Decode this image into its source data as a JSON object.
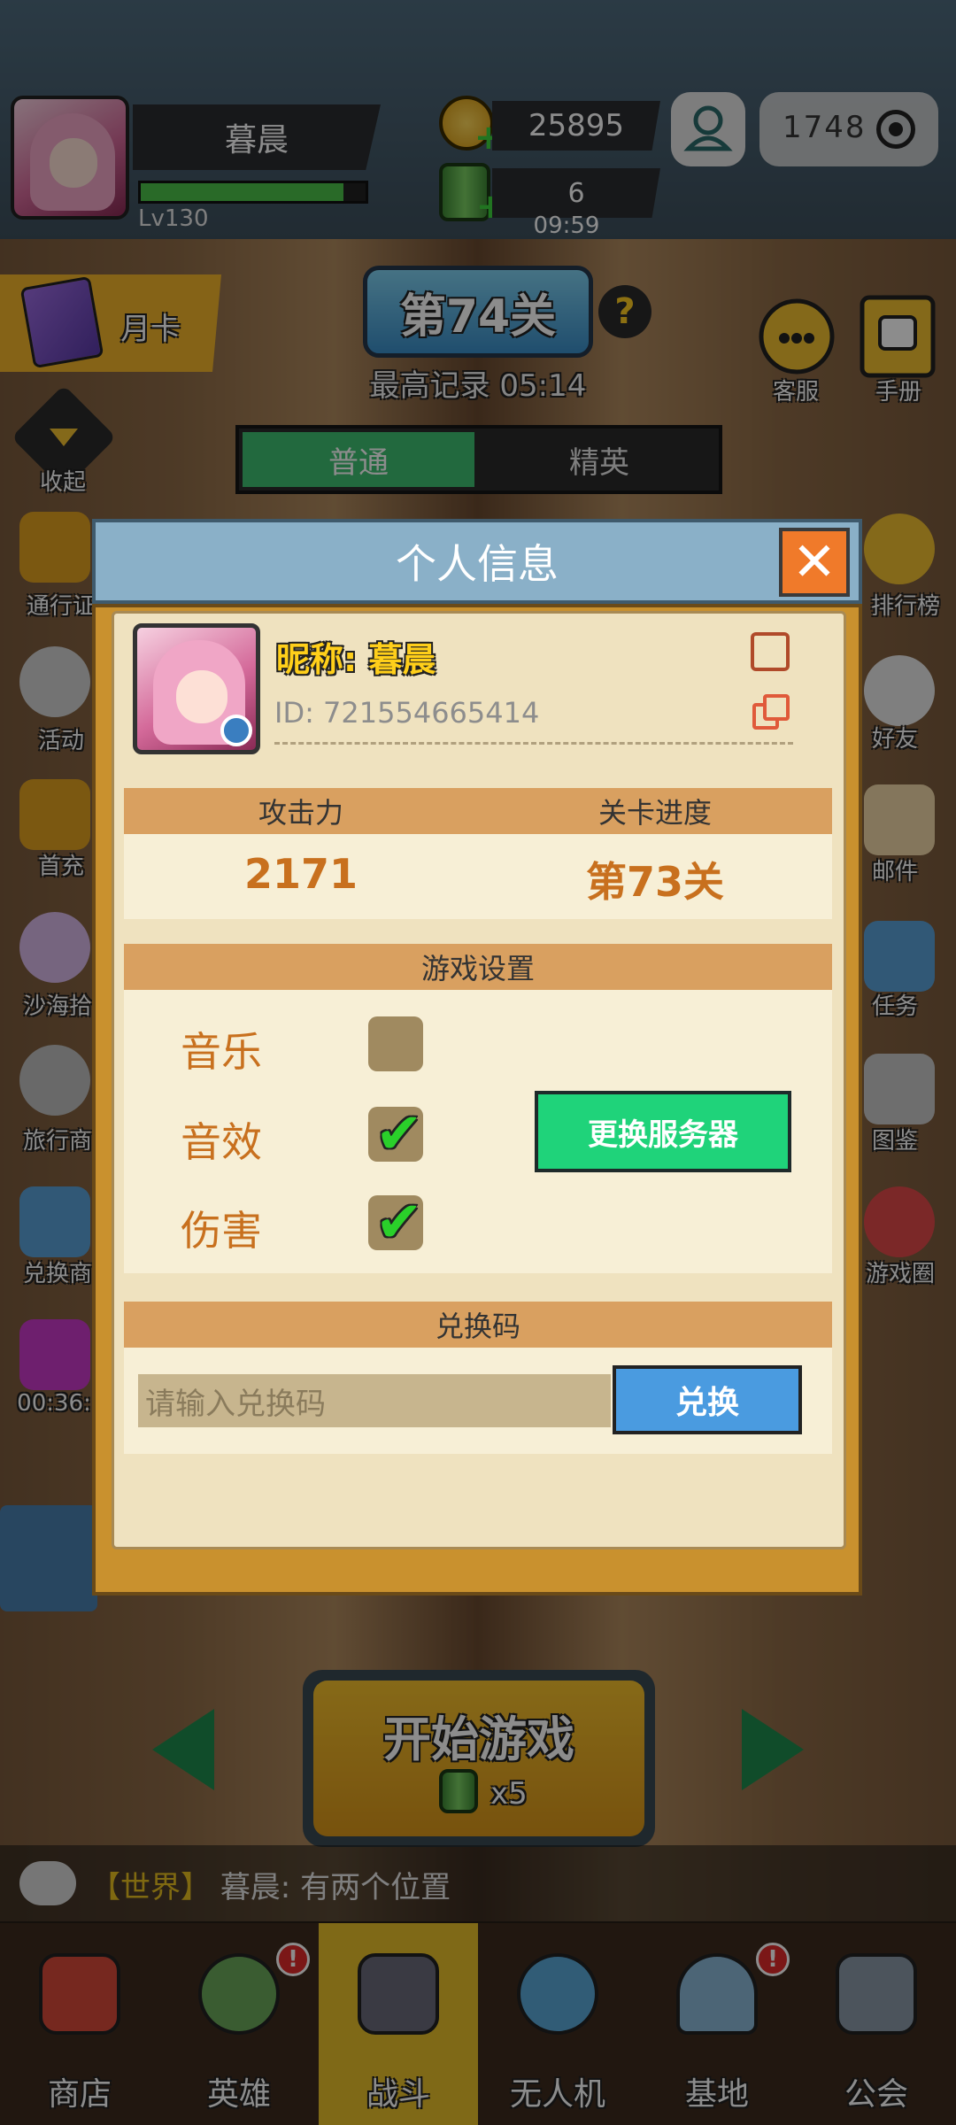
{
  "header": {
    "player_name": "暮晨",
    "level": "Lv130",
    "xp_fraction": 0.9,
    "coins": "25895",
    "energy": "6",
    "energy_timer": "09:59",
    "capsule_value": "1748"
  },
  "stage": {
    "title": "第74关",
    "best_record": "最高记录 05:14",
    "tabs": [
      "普通",
      "精英"
    ]
  },
  "left_menu": [
    {
      "label": "月卡"
    },
    {
      "label": "收起"
    },
    {
      "label": "通行证"
    },
    {
      "label": "活动"
    },
    {
      "label": "首充"
    },
    {
      "label": "沙海拾"
    },
    {
      "label": "旅行商"
    },
    {
      "label": "兑换商"
    },
    {
      "label": "00:36:"
    }
  ],
  "right_menu": [
    {
      "label": "客服"
    },
    {
      "label": "手册"
    },
    {
      "label": "排行榜"
    },
    {
      "label": "好友"
    },
    {
      "label": "邮件"
    },
    {
      "label": "任务"
    },
    {
      "label": "图鉴"
    },
    {
      "label": "游戏圈"
    }
  ],
  "modal": {
    "title": "个人信息",
    "nickname": "昵称: 暮晨",
    "id": "ID: 721554665414",
    "stats_headers": [
      "攻击力",
      "关卡进度"
    ],
    "stats_values": [
      "2171",
      "第73关"
    ],
    "settings_header": "游戏设置",
    "settings": [
      {
        "label": "音乐",
        "checked": false
      },
      {
        "label": "音效",
        "checked": true
      },
      {
        "label": "伤害",
        "checked": true
      }
    ],
    "switch_server": "更换服务器",
    "redeem_header": "兑换码",
    "redeem_placeholder": "请输入兑换码",
    "redeem_button": "兑换"
  },
  "start": {
    "label": "开始游戏",
    "cost": "x5"
  },
  "chat": {
    "channel": "【世界】",
    "message": "暮晨: 有两个位置"
  },
  "nav": [
    {
      "label": "商店"
    },
    {
      "label": "英雄"
    },
    {
      "label": "战斗"
    },
    {
      "label": "无人机"
    },
    {
      "label": "基地"
    },
    {
      "label": "公会"
    }
  ],
  "colors": {
    "accent_green": "#1fd37a",
    "accent_blue": "#4a9be0",
    "accent_orange": "#c8701e",
    "close_orange": "#f07a2a"
  }
}
